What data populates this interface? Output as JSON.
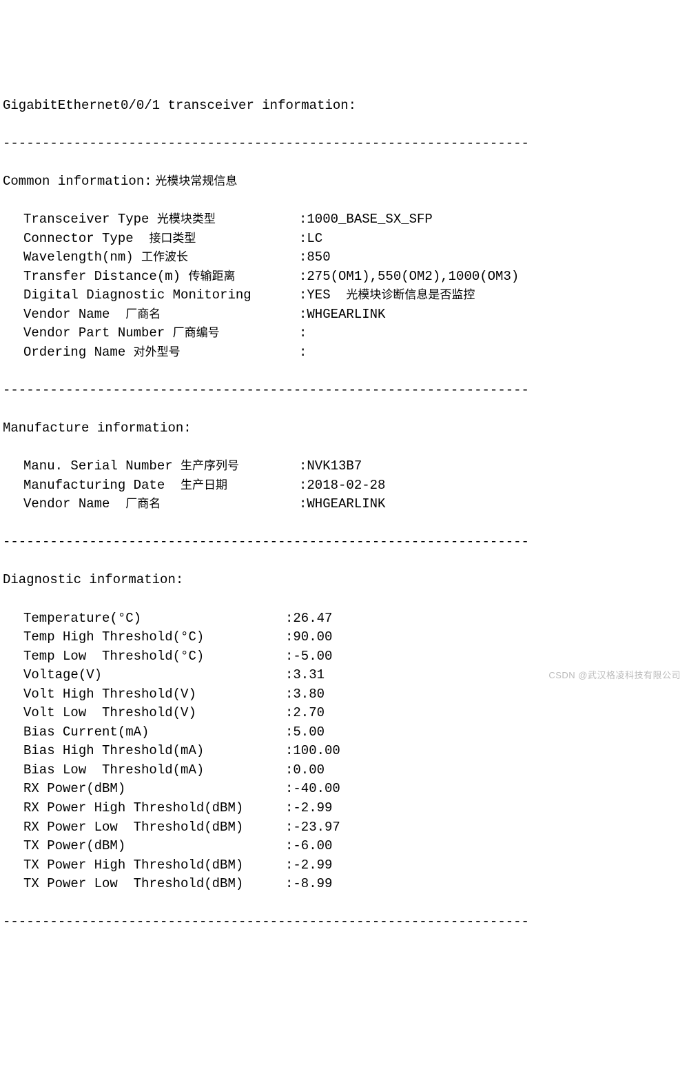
{
  "title": "GigabitEthernet0/0/1 transceiver information:",
  "dash": "-------------------------------------------------------------------",
  "common": {
    "heading_en": "Common information:",
    "heading_cn": " 光模块常规信息",
    "rows": [
      {
        "label_en": "Transceiver Type ",
        "label_cn": "光模块类型",
        "value": ":1000_BASE_SX_SFP"
      },
      {
        "label_en": "Connector Type  ",
        "label_cn": "接口类型",
        "value": ":LC"
      },
      {
        "label_en": "Wavelength(nm) ",
        "label_cn": "工作波长",
        "value": ":850"
      },
      {
        "label_en": "Transfer Distance(m) ",
        "label_cn": "传输距离",
        "value": ":275(OM1),550(OM2),1000(OM3)"
      },
      {
        "label_en": "Digital Diagnostic Monitoring",
        "label_cn": "",
        "value": ":YES  ",
        "tail_cn": "光模块诊断信息是否监控"
      },
      {
        "label_en": "Vendor Name  ",
        "label_cn": "厂商名",
        "value": ":",
        "tail_en": "WHGEARLINK"
      },
      {
        "label_en": "Vendor Part Number ",
        "label_cn": "厂商编号",
        "value": ":"
      },
      {
        "label_en": "Ordering Name ",
        "label_cn": "对外型号",
        "value": ":"
      }
    ]
  },
  "manufacture": {
    "heading": "Manufacture information:",
    "rows": [
      {
        "label_en": "Manu. Serial Number ",
        "label_cn": "生产序列号",
        "value": ":NVK13B7"
      },
      {
        "label_en": "Manufacturing Date  ",
        "label_cn": "生产日期",
        "value": ":2018-02-28"
      },
      {
        "label_en": "Vendor Name  ",
        "label_cn": "厂商名",
        "value": ":",
        "tail_en": "WHGEARLINK"
      }
    ]
  },
  "diagnostic": {
    "heading": "Diagnostic information:",
    "rows": [
      {
        "label": "Temperature(°C)",
        "value": ":26.47"
      },
      {
        "label": "Temp High Threshold(°C)",
        "value": ":90.00"
      },
      {
        "label": "Temp Low  Threshold(°C)",
        "value": ":-5.00"
      },
      {
        "label": "Voltage(V)",
        "value": ":3.31"
      },
      {
        "label": "Volt High Threshold(V)",
        "value": ":3.80"
      },
      {
        "label": "Volt Low  Threshold(V)",
        "value": ":2.70"
      },
      {
        "label": "Bias Current(mA)",
        "value": ":5.00"
      },
      {
        "label": "Bias High Threshold(mA)",
        "value": ":100.00"
      },
      {
        "label": "Bias Low  Threshold(mA)",
        "value": ":0.00"
      },
      {
        "label": "RX Power(dBM)",
        "value": ":-40.00"
      },
      {
        "label": "RX Power High Threshold(dBM)",
        "value": ":-2.99"
      },
      {
        "label": "RX Power Low  Threshold(dBM)",
        "value": ":-23.97"
      },
      {
        "label": "TX Power(dBM)",
        "value": ":-6.00"
      },
      {
        "label": "TX Power High Threshold(dBM)",
        "value": ":-2.99"
      },
      {
        "label": "TX Power Low  Threshold(dBM)",
        "value": ":-8.99"
      }
    ]
  },
  "watermark": "CSDN @武汉格凌科技有限公司"
}
